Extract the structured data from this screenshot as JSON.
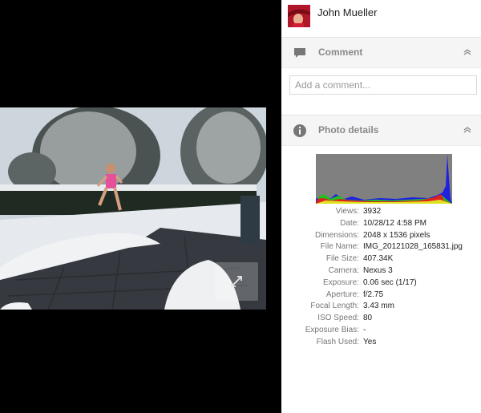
{
  "user": {
    "name": "John Mueller"
  },
  "comment": {
    "title": "Comment",
    "placeholder": "Add a comment..."
  },
  "photo_details": {
    "title": "Photo details",
    "rows": [
      {
        "label": "Views:",
        "value": "3932"
      },
      {
        "label": "Date:",
        "value": "10/28/12 4:58 PM"
      },
      {
        "label": "Dimensions:",
        "value": "2048 x 1536 pixels"
      },
      {
        "label": "File Name:",
        "value": "IMG_20121028_165831.jpg"
      },
      {
        "label": "File Size:",
        "value": "407.34K"
      },
      {
        "label": "Camera:",
        "value": "Nexus 3"
      },
      {
        "label": "Exposure:",
        "value": "0.06 sec (1/17)"
      },
      {
        "label": "Aperture:",
        "value": "f/2.75"
      },
      {
        "label": "Focal Length:",
        "value": "3.43 mm"
      },
      {
        "label": "ISO Speed:",
        "value": "80"
      },
      {
        "label": "Exposure Bias:",
        "value": "-"
      },
      {
        "label": "Flash Used:",
        "value": "Yes"
      }
    ]
  },
  "icons": {
    "comment": "speech-bubble-icon",
    "info": "info-icon",
    "collapse": "chevron-up-icon",
    "expand": "expand-icon"
  },
  "colors": {
    "panel_header": "#f5f5f5",
    "accent_gray": "#888888",
    "background": "#000000"
  }
}
